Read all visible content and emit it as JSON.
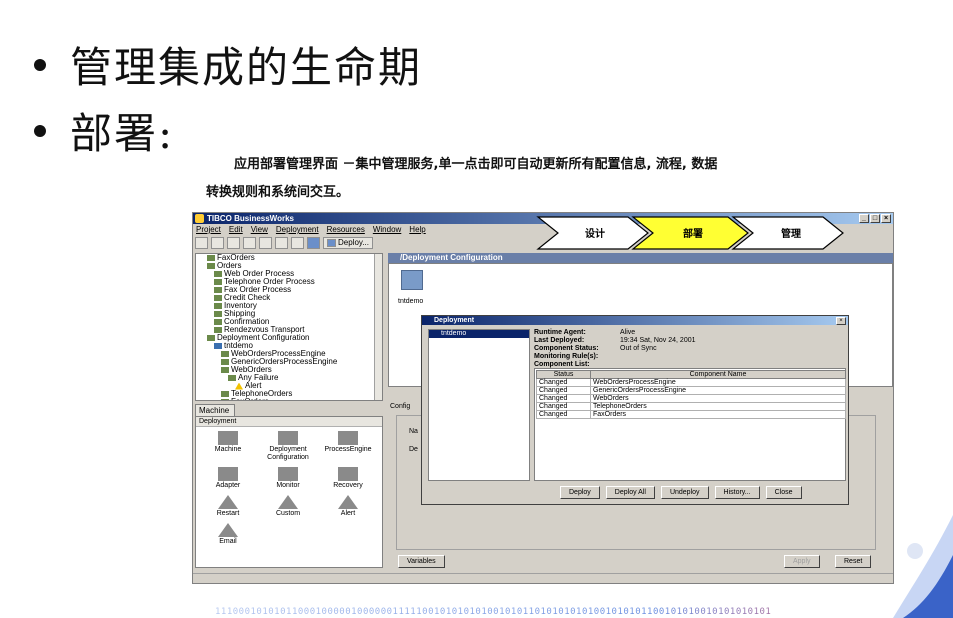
{
  "slide": {
    "bullet1": "管理集成的生命期",
    "bullet2": "部署:",
    "caption_line1": "应用部署管理界面 －集中管理服务,单一点击即可自动更新所有配置信息, 流程, 数据",
    "caption_line2": "转换规则和系统间交互。",
    "footer_bits": "1110001010101100010000010000001111100101010101001010110101010101001010101100101010010101010101"
  },
  "app": {
    "title": "TIBCO BusinessWorks",
    "menus": [
      "Project",
      "Edit",
      "View",
      "Deployment",
      "Resources",
      "Window",
      "Help"
    ],
    "toolbar_deploy": "Deploy...",
    "chevrons": [
      "设计",
      "部署",
      "管理"
    ],
    "tree": [
      {
        "label": "FaxOrders",
        "indent": 1
      },
      {
        "label": "Orders",
        "indent": 1
      },
      {
        "label": "Web Order Process",
        "indent": 2
      },
      {
        "label": "Telephone Order Process",
        "indent": 2
      },
      {
        "label": "Fax Order Process",
        "indent": 2
      },
      {
        "label": "Credit Check",
        "indent": 2
      },
      {
        "label": "Inventory",
        "indent": 2
      },
      {
        "label": "Shipping",
        "indent": 2
      },
      {
        "label": "Confirmation",
        "indent": 2
      },
      {
        "label": "Rendezvous Transport",
        "indent": 2
      },
      {
        "label": "Deployment Configuration",
        "indent": 1
      },
      {
        "label": "tntdemo",
        "indent": 2
      },
      {
        "label": "WebOrdersProcessEngine",
        "indent": 3
      },
      {
        "label": "GenericOrdersProcessEngine",
        "indent": 3
      },
      {
        "label": "WebOrders",
        "indent": 3
      },
      {
        "label": "Any Failure",
        "indent": 4
      },
      {
        "label": "Alert",
        "indent": 5
      },
      {
        "label": "TelephoneOrders",
        "indent": 3
      },
      {
        "label": "FaxOrders",
        "indent": 3
      }
    ],
    "palette_tab": "Machine",
    "palette_header": "Deployment",
    "palette": [
      {
        "label": "Machine",
        "shape": "box"
      },
      {
        "label": "Deployment Configuration",
        "shape": "box"
      },
      {
        "label": "ProcessEngine",
        "shape": "box"
      },
      {
        "label": "Adapter",
        "shape": "box"
      },
      {
        "label": "Monitor",
        "shape": "box"
      },
      {
        "label": "Recovery",
        "shape": "box"
      },
      {
        "label": "Restart",
        "shape": "tri"
      },
      {
        "label": "Custom",
        "shape": "tri"
      },
      {
        "label": "Alert",
        "shape": "tri"
      },
      {
        "label": "Email",
        "shape": "tri"
      }
    ],
    "right_header": "/Deployment Configuration",
    "node_label": "tntdemo",
    "config_tab": "Config",
    "name_label": "Na",
    "desc_label": "De",
    "variables_button": "Variables",
    "apply_button": "Apply",
    "reset_button": "Reset"
  },
  "dialog": {
    "title": "Deployment",
    "list_item": "tntdemo",
    "info": [
      {
        "key": "Runtime Agent:",
        "value": "Alive"
      },
      {
        "key": "Last Deployed:",
        "value": "19:34 Sat, Nov 24, 2001"
      },
      {
        "key": "Component Status:",
        "value": "Out of Sync"
      },
      {
        "key": "Monitoring Rule(s):",
        "value": ""
      },
      {
        "key": "Component List:",
        "value": ""
      }
    ],
    "table_headers": [
      "Status",
      "Component Name"
    ],
    "table_rows": [
      [
        "Changed",
        "WebOrdersProcessEngine"
      ],
      [
        "Changed",
        "GenericOrdersProcessEngine"
      ],
      [
        "Changed",
        "WebOrders"
      ],
      [
        "Changed",
        "TelephoneOrders"
      ],
      [
        "Changed",
        "FaxOrders"
      ]
    ],
    "buttons": [
      "Deploy",
      "Deploy All",
      "Undeploy",
      "History...",
      "Close"
    ]
  }
}
